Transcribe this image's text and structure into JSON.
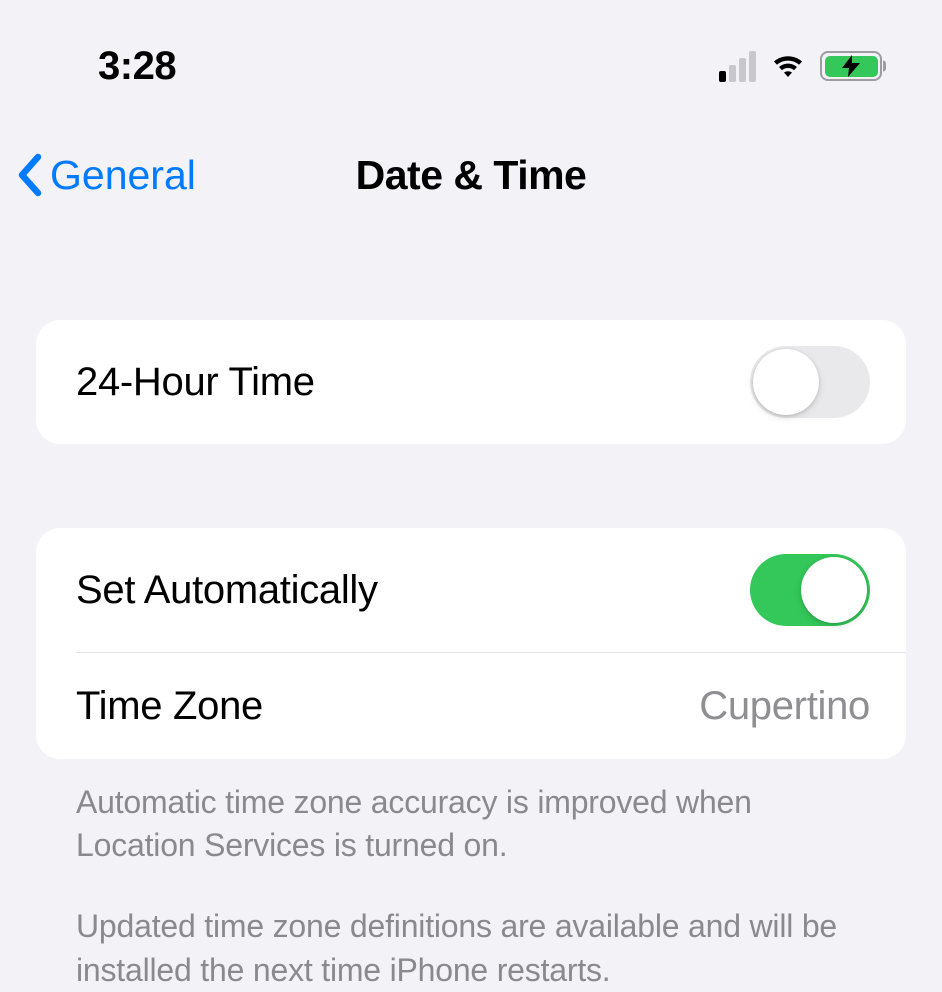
{
  "statusBar": {
    "time": "3:28"
  },
  "nav": {
    "back": "General",
    "title": "Date & Time"
  },
  "rows": {
    "twentyFourHour": {
      "label": "24-Hour Time",
      "enabled": false
    },
    "setAutomatically": {
      "label": "Set Automatically",
      "enabled": true
    },
    "timeZone": {
      "label": "Time Zone",
      "value": "Cupertino"
    }
  },
  "footer": {
    "line1": "Automatic time zone accuracy is improved when Location Services is turned on.",
    "line2": "Updated time zone definitions are available and will be installed the next time iPhone restarts."
  }
}
